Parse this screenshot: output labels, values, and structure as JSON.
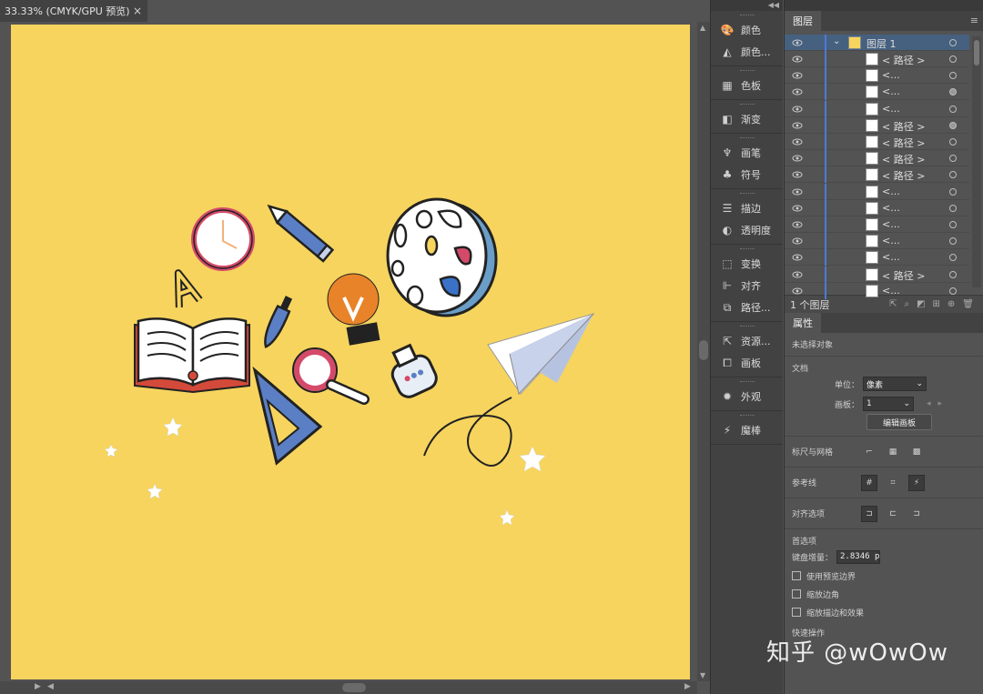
{
  "document": {
    "tab_title": "33.33% (CMYK/GPU 预览)",
    "close_glyph": "×"
  },
  "dock": {
    "items": [
      {
        "label": "颜色",
        "icon": "palette-icon"
      },
      {
        "label": "颜色...",
        "icon": "color-guide-icon"
      },
      {
        "label": "色板",
        "icon": "swatches-icon"
      },
      {
        "label": "渐变",
        "icon": "gradient-icon"
      },
      {
        "label": "画笔",
        "icon": "brush-icon"
      },
      {
        "label": "符号",
        "icon": "symbol-club-icon"
      },
      {
        "label": "描边",
        "icon": "stroke-icon"
      },
      {
        "label": "透明度",
        "icon": "transparency-icon"
      },
      {
        "label": "变换",
        "icon": "transform-icon"
      },
      {
        "label": "对齐",
        "icon": "align-icon"
      },
      {
        "label": "路径...",
        "icon": "pathfinder-icon"
      },
      {
        "label": "资源...",
        "icon": "asset-export-icon"
      },
      {
        "label": "画板",
        "icon": "artboards-icon"
      },
      {
        "label": "外观",
        "icon": "appearance-icon"
      },
      {
        "label": "魔棒",
        "icon": "magic-wand-icon"
      }
    ]
  },
  "layers_panel": {
    "tab": "图层",
    "top_layer": {
      "label": "图层 1"
    },
    "rows": [
      {
        "label": "< 路径 >",
        "target": "empty"
      },
      {
        "label": "<...",
        "target": "empty"
      },
      {
        "label": "<...",
        "target": "filled"
      },
      {
        "label": "<...",
        "target": "empty"
      },
      {
        "label": "< 路径 >",
        "target": "filled"
      },
      {
        "label": "< 路径 >",
        "target": "empty"
      },
      {
        "label": "< 路径 >",
        "target": "empty"
      },
      {
        "label": "< 路径 >",
        "target": "empty"
      },
      {
        "label": "<...",
        "target": "empty"
      },
      {
        "label": "<...",
        "target": "empty"
      },
      {
        "label": "<...",
        "target": "empty"
      },
      {
        "label": "<...",
        "target": "empty"
      },
      {
        "label": "<...",
        "target": "empty"
      },
      {
        "label": "< 路径 >",
        "target": "empty"
      },
      {
        "label": "<...",
        "target": "empty"
      }
    ],
    "footer": "1 个图层"
  },
  "properties_panel": {
    "tab": "属性",
    "selection_status": "未选择对象",
    "document_label": "文档",
    "unit_label": "单位：",
    "unit_value": "像素",
    "artboard_label": "画板：",
    "artboard_value": "1",
    "edit_artboards_button": "编辑画板",
    "rulers_grids_label": "标尺与网格",
    "guides_label": "参考线",
    "snap_options_label": "对齐选项",
    "preferences_label": "首选项",
    "keyboard_increment_label": "键盘增量：",
    "keyboard_increment_value": "2.8346 p",
    "use_preview_bounds": "使用预览边界",
    "scale_corners": "缩放边角",
    "scale_strokes": "缩放描边和效果",
    "quick_actions_label": "快速操作"
  },
  "watermark": "知乎 @wOwOw",
  "colors": {
    "artboard": "#f6d45e",
    "selection_blue": "#4d79d6",
    "panel_bg": "#535353"
  }
}
